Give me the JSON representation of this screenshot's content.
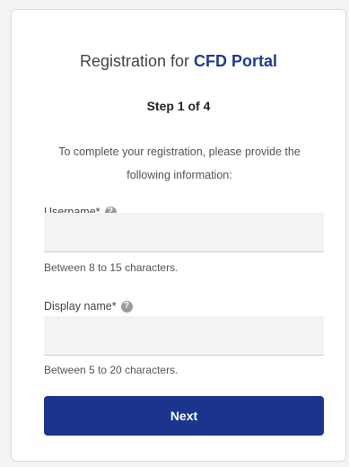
{
  "header": {
    "title_prefix": "Registration for ",
    "title_brand": "CFD Portal",
    "step": "Step 1 of 4"
  },
  "intro": {
    "text": "To complete your registration, please provide the following information:"
  },
  "form": {
    "username": {
      "label": "Username*",
      "help_icon": "question-circle-icon",
      "help_glyph": "?",
      "value": "",
      "placeholder": "",
      "hint": "Between 8 to 15 characters."
    },
    "display_name": {
      "label": "Display name*",
      "help_icon": "question-circle-icon",
      "help_glyph": "?",
      "value": "",
      "placeholder": "",
      "hint": "Between 5 to 20 characters."
    },
    "next_label": "Next"
  },
  "colors": {
    "brand": "#1f3a8a",
    "button": "#1b358e",
    "input_background": "#f3f3f3"
  }
}
